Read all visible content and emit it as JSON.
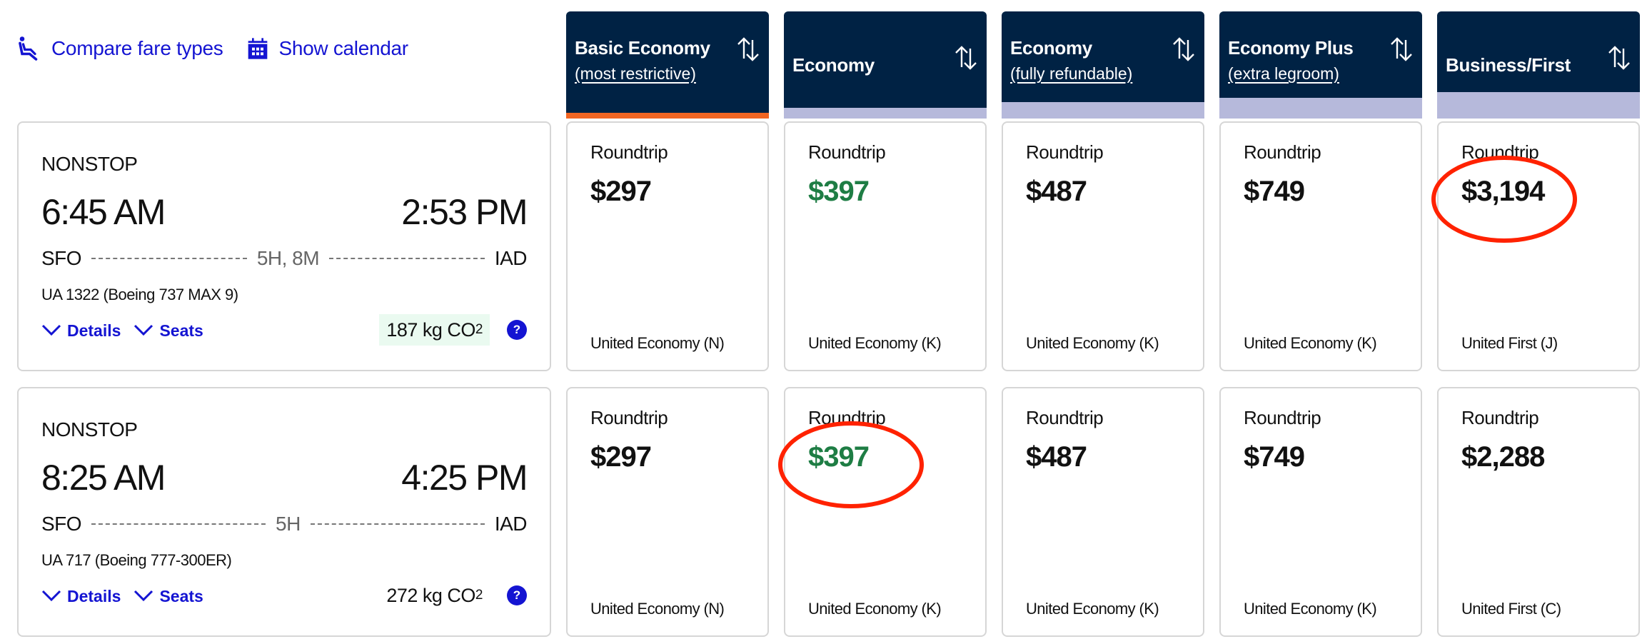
{
  "theme": {
    "link_color": "#1414d2",
    "header_bg": "#002244",
    "basic_stripe": "#f26522",
    "other_stripe": "#b6b9db",
    "price_highlight": "#1e7d44",
    "co2_badge_bg": "#eafaf0",
    "annotation_color": "#ff2200"
  },
  "toolbar": {
    "compare_label": "Compare fare types",
    "compare_icon": "seat-icon",
    "calendar_label": "Show calendar",
    "calendar_icon": "calendar-icon"
  },
  "columns": [
    {
      "title": "Basic Economy",
      "subtitle": "(most restrictive)",
      "sort_icon": "sort-icon",
      "selected": true
    },
    {
      "title": "Economy",
      "subtitle": "",
      "sort_icon": "sort-icon",
      "selected": false
    },
    {
      "title": "Economy",
      "subtitle": "(fully refundable)",
      "sort_icon": "sort-icon",
      "selected": false
    },
    {
      "title": "Economy Plus",
      "subtitle": "(extra legroom)",
      "sort_icon": "sort-icon",
      "selected": false
    },
    {
      "title": "Business/First",
      "subtitle": "",
      "sort_icon": "sort-icon",
      "selected": false
    }
  ],
  "flights": [
    {
      "stops": "NONSTOP",
      "depart_time": "6:45 AM",
      "arrive_time": "2:53 PM",
      "origin": "SFO",
      "destination": "IAD",
      "duration": "5H, 8M",
      "equipment": "UA 1322 (Boeing 737 MAX 9)",
      "details_label": "Details",
      "seats_label": "Seats",
      "co2_value": "187 kg CO",
      "co2_sub": "2",
      "co2_highlighted": true,
      "help_label": "?",
      "fares": [
        {
          "label": "Roundtrip",
          "price": "$297",
          "fare_class": "United Economy (N)",
          "highlight": false,
          "annotated": false
        },
        {
          "label": "Roundtrip",
          "price": "$397",
          "fare_class": "United Economy (K)",
          "highlight": true,
          "annotated": false
        },
        {
          "label": "Roundtrip",
          "price": "$487",
          "fare_class": "United Economy (K)",
          "highlight": false,
          "annotated": false
        },
        {
          "label": "Roundtrip",
          "price": "$749",
          "fare_class": "United Economy (K)",
          "highlight": false,
          "annotated": false
        },
        {
          "label": "Roundtrip",
          "price": "$3,194",
          "fare_class": "United First (J)",
          "highlight": false,
          "annotated": true
        }
      ]
    },
    {
      "stops": "NONSTOP",
      "depart_time": "8:25 AM",
      "arrive_time": "4:25 PM",
      "origin": "SFO",
      "destination": "IAD",
      "duration": "5H",
      "equipment": "UA 717 (Boeing 777-300ER)",
      "details_label": "Details",
      "seats_label": "Seats",
      "co2_value": "272 kg CO",
      "co2_sub": "2",
      "co2_highlighted": false,
      "help_label": "?",
      "fares": [
        {
          "label": "Roundtrip",
          "price": "$297",
          "fare_class": "United Economy (N)",
          "highlight": false,
          "annotated": false
        },
        {
          "label": "Roundtrip",
          "price": "$397",
          "fare_class": "United Economy (K)",
          "highlight": true,
          "annotated": true
        },
        {
          "label": "Roundtrip",
          "price": "$487",
          "fare_class": "United Economy (K)",
          "highlight": false,
          "annotated": false
        },
        {
          "label": "Roundtrip",
          "price": "$749",
          "fare_class": "United Economy (K)",
          "highlight": false,
          "annotated": false
        },
        {
          "label": "Roundtrip",
          "price": "$2,288",
          "fare_class": "United First (C)",
          "highlight": false,
          "annotated": false
        }
      ]
    }
  ]
}
